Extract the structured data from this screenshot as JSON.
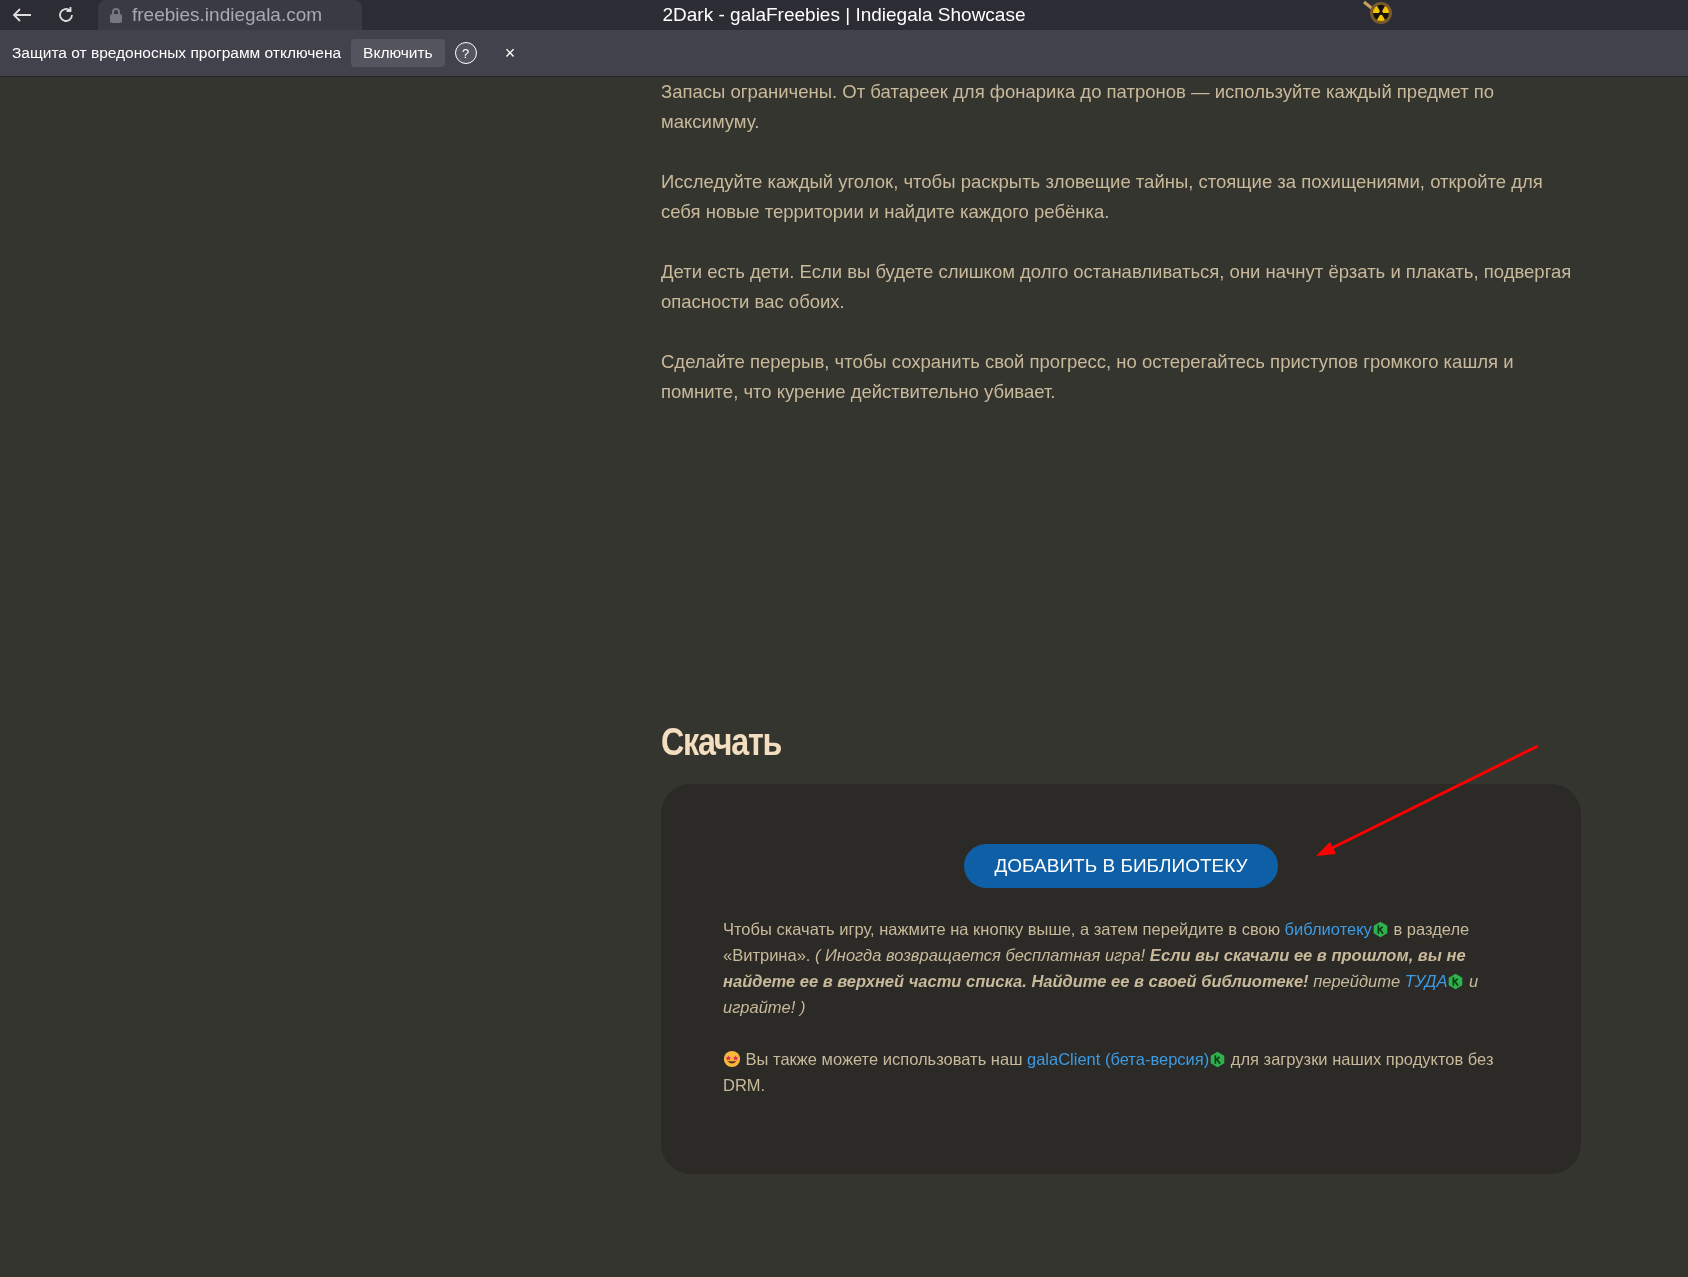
{
  "browser": {
    "url": "freebies.indiegala.com",
    "title": "2Dark - galaFreebies | Indiegala Showcase"
  },
  "infobar": {
    "message": "Защита от вредоносных программ отключена",
    "button": "Включить",
    "help": "?",
    "close": "×"
  },
  "paragraphs": [
    "Запасы ограничены. От батареек для фонарика до патронов — используйте каждый предмет по максимуму.",
    "Исследуйте каждый уголок, чтобы раскрыть зловещие тайны, стоящие за похищениями, откройте для себя новые территории и найдите каждого ребёнка.",
    "Дети есть дети. Если вы будете слишком долго останавливаться, они начнут ёрзать и плакать, подвергая опасности вас обоих.",
    "Сделайте перерыв, чтобы сохранить свой прогресс, но остерегайтесь приступов громкого кашля и помните, что курение действительно убивает."
  ],
  "download": {
    "heading": "Скачать",
    "button": "ДОБАВИТЬ В БИБЛИОТЕКУ",
    "notes": [
      [
        {
          "kind": "plain",
          "text": "Чтобы скачать игру, нажмите на кнопку выше, а затем перейдите в свою "
        },
        {
          "kind": "link",
          "text": "библиотеку"
        },
        {
          "kind": "plain",
          "text": " в разделе «Витрина». "
        },
        {
          "kind": "italic",
          "text": "( Иногда возвращается бесплатная игра! "
        },
        {
          "kind": "bolditalic",
          "text": "Если вы скачали ее в прошлом, вы не найдете ее в верхней части списка. Найдите ее в своей библиотеке!"
        },
        {
          "kind": "italic",
          "text": " перейдите "
        },
        {
          "kind": "italiclink",
          "text": "ТУДА"
        },
        {
          "kind": "italic",
          "text": " и играйте! )"
        }
      ],
      [
        {
          "kind": "emoji"
        },
        {
          "kind": "plain",
          "text": " Вы также можете использовать наш "
        },
        {
          "kind": "link",
          "text": "galaClient (бета-версия)"
        },
        {
          "kind": "plain",
          "text": " для загрузки наших продуктов без DRM."
        }
      ]
    ]
  }
}
